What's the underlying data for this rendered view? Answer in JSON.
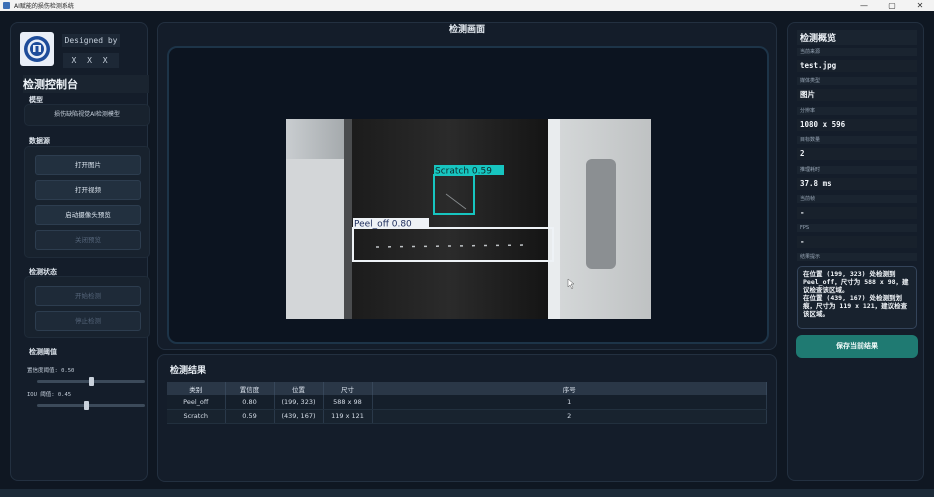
{
  "window": {
    "title": "AI赋能的损伤检测系统",
    "controls": [
      "—",
      "▢",
      "✕"
    ]
  },
  "left": {
    "designed_by": "Designed by",
    "author": "X X X",
    "console_title": "检测控制台",
    "model_section": "模型",
    "model_name": "损伤缺陷视觉AI检测模型",
    "source_section": "数据源",
    "buttons": {
      "open_image": "打开图片",
      "open_video": "打开视频",
      "start_camera": "启动摄像头预览",
      "close_preview": "关闭预览"
    },
    "status_section": "检测状态",
    "start_detect": "开始检测",
    "stop_detect": "停止检测",
    "threshold_section": "检测阈值",
    "conf_label": "置信度阈值: 0.50",
    "conf_value": 0.5,
    "iou_label": "IOU 阈值: 0.45",
    "iou_value": 0.45
  },
  "center": {
    "view_title": "检测画面",
    "detections": [
      {
        "label": "Scratch  0.59",
        "color": "#17c5c0"
      },
      {
        "label": "Peel_off  0.80",
        "color": "#eef2f6"
      }
    ],
    "results_title": "检测结果",
    "columns": [
      "类别",
      "置信度",
      "位置",
      "尺寸",
      "序号"
    ],
    "rows": [
      [
        "Peel_off",
        "0.80",
        "(199, 323)",
        "588 x 98",
        "1"
      ],
      [
        "Scratch",
        "0.59",
        "(439, 167)",
        "119 x 121",
        "2"
      ]
    ]
  },
  "right": {
    "title": "检测概览",
    "fields": [
      {
        "label": "当前来源",
        "value": "test.jpg"
      },
      {
        "label": "媒体类型",
        "value": "图片"
      },
      {
        "label": "分辨率",
        "value": "1080 x 596"
      },
      {
        "label": "目标数量",
        "value": "2"
      },
      {
        "label": "推理耗时",
        "value": "37.8 ms"
      },
      {
        "label": "当前帧",
        "value": "-"
      },
      {
        "label": "FPS",
        "value": "-"
      }
    ],
    "tip_label": "结果提示",
    "tip_text": "在位置 (199, 323) 处检测到 Peel_off，尺寸为 588 x 98，建议检查该区域。\n在位置 (439, 167) 处检测到划痕，尺寸为 119 x 121，建议检查该区域。",
    "save_button": "保存当前结果"
  },
  "colors": {
    "accent": "#1f7a72",
    "background": "#0f1722"
  }
}
